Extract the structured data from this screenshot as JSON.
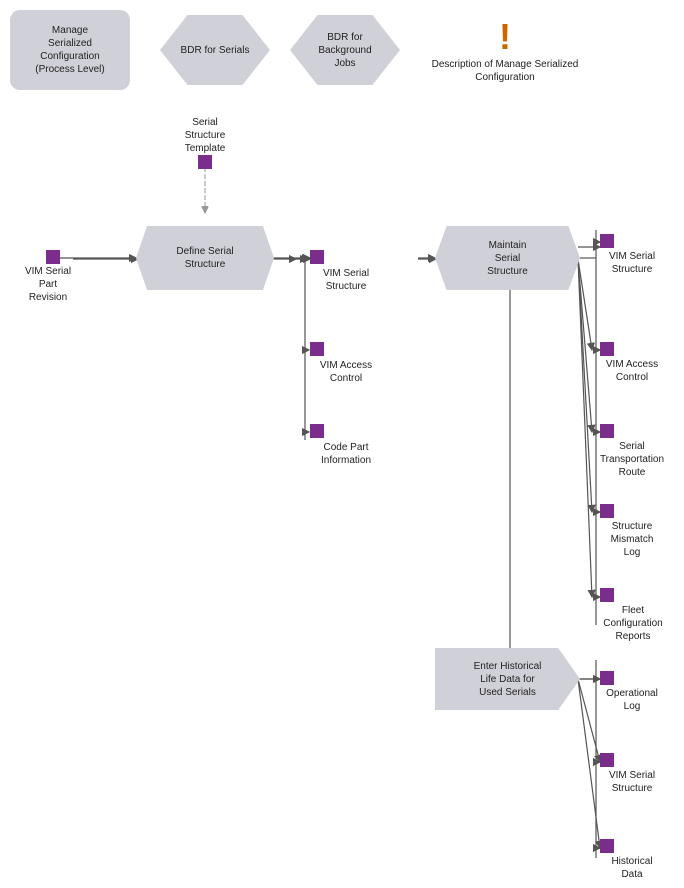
{
  "nodes": {
    "manage_serialized": {
      "label": "Manage\nSerialized\nConfiguration\n(Process Level)"
    },
    "bdr_serials": {
      "label": "BDR for Serials"
    },
    "bdr_background": {
      "label": "BDR for\nBackground\nJobs"
    },
    "description": {
      "label": "Description of\nManage Serialized\nConfiguration"
    },
    "serial_structure_template": {
      "label": "Serial\nStructure\nTemplate"
    },
    "define_serial_structure": {
      "label": "Define Serial\nStructure"
    },
    "vim_serial_part_revision": {
      "label": "VIM Serial\nPart\nRevision"
    },
    "vim_serial_structure_1": {
      "label": "VIM Serial\nStructure"
    },
    "vim_access_control_1": {
      "label": "VIM Access\nControl"
    },
    "code_part_information": {
      "label": "Code Part\nInformation"
    },
    "maintain_serial_structure": {
      "label": "Maintain\nSerial\nStructure"
    },
    "vim_serial_structure_2": {
      "label": "VIM Serial\nStructure"
    },
    "vim_access_control_2": {
      "label": "VIM Access\nControl"
    },
    "serial_transportation_route": {
      "label": "Serial\nTransportation\nRoute"
    },
    "structure_mismatch_log": {
      "label": "Structure\nMismatch\nLog"
    },
    "fleet_configuration_reports": {
      "label": "Fleet\nConfiguration\nReports"
    },
    "enter_historical": {
      "label": "Enter Historical\nLife Data for\nUsed Serials"
    },
    "operational_log": {
      "label": "Operational\nLog"
    },
    "vim_serial_structure_3": {
      "label": "VIM Serial\nStructure"
    },
    "historical_data": {
      "label": "Historical\nData"
    }
  }
}
